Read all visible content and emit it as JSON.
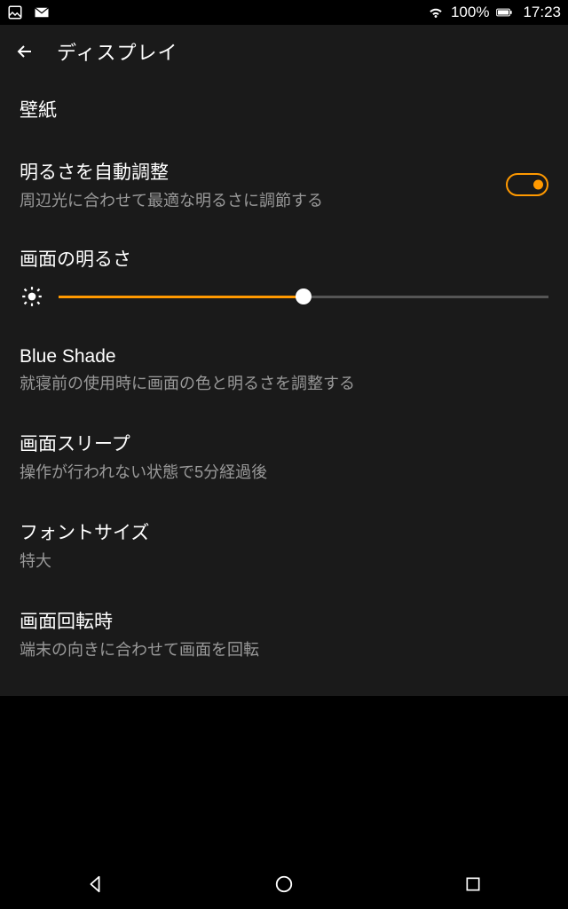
{
  "status": {
    "battery": "100%",
    "time": "17:23"
  },
  "header": {
    "title": "ディスプレイ"
  },
  "settings": {
    "wallpaper": {
      "title": "壁紙"
    },
    "autoBrightness": {
      "title": "明るさを自動調整",
      "subtitle": "周辺光に合わせて最適な明るさに調節する",
      "enabled": true
    },
    "brightness": {
      "title": "画面の明るさ",
      "value": 50
    },
    "blueShade": {
      "title": "Blue Shade",
      "subtitle": "就寝前の使用時に画面の色と明るさを調整する"
    },
    "sleep": {
      "title": "画面スリープ",
      "subtitle": "操作が行われない状態で5分経過後"
    },
    "fontSize": {
      "title": "フォントサイズ",
      "subtitle": "特大"
    },
    "rotation": {
      "title": "画面回転時",
      "subtitle": "端末の向きに合わせて画面を回転"
    }
  }
}
